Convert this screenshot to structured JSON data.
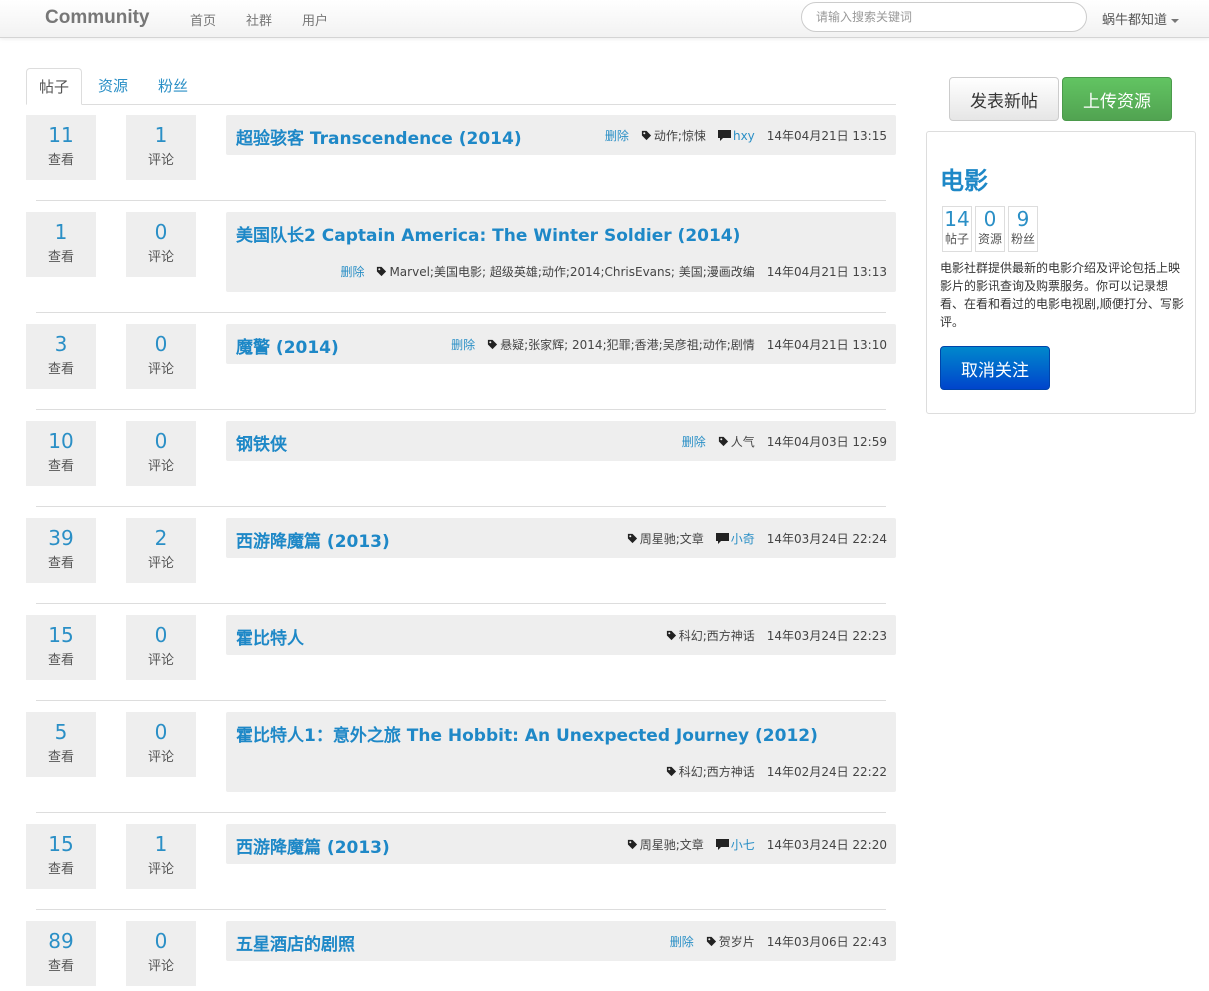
{
  "nav": {
    "brand": "Community",
    "links": [
      "首页",
      "社群",
      "用户"
    ],
    "search_placeholder": "请输入搜索关键词",
    "user": "蜗牛都知道"
  },
  "tabs": [
    "帖子",
    "资源",
    "粉丝"
  ],
  "labels": {
    "views": "查看",
    "comments": "评论",
    "delete": "删除"
  },
  "posts": [
    {
      "views": "11",
      "comments": "1",
      "title": "超验骇客 Transcendence (2014)",
      "delete": true,
      "tags": "动作;惊悚",
      "author": "hxy",
      "time": "14年04月21日 13:15"
    },
    {
      "views": "1",
      "comments": "0",
      "title": "美国队长2 Captain America: The Winter Soldier (2014)",
      "delete": true,
      "tags": "Marvel;美国电影; 超级英雄;动作;2014;ChrisEvans; 美国;漫画改编",
      "author": "",
      "time": "14年04月21日 13:13"
    },
    {
      "views": "3",
      "comments": "0",
      "title": "魔警 (2014)",
      "delete": true,
      "tags": "悬疑;张家辉; 2014;犯罪;香港;吴彦祖;动作;剧情",
      "author": "",
      "time": "14年04月21日 13:10"
    },
    {
      "views": "10",
      "comments": "0",
      "title": "钢铁侠",
      "delete": true,
      "tags": "人气",
      "author": "",
      "time": "14年04月03日 12:59"
    },
    {
      "views": "39",
      "comments": "2",
      "title": "西游降魔篇 (2013)",
      "delete": false,
      "tags": "周星驰;文章",
      "author": "小奇",
      "time": "14年03月24日 22:24"
    },
    {
      "views": "15",
      "comments": "0",
      "title": "霍比特人",
      "delete": false,
      "tags": "科幻;西方神话",
      "author": "",
      "time": "14年03月24日 22:23"
    },
    {
      "views": "5",
      "comments": "0",
      "title": "霍比特人1：意外之旅 The Hobbit: An Unexpected Journey (2012)",
      "delete": false,
      "tags": "科幻;西方神话",
      "author": "",
      "time": "14年02月24日 22:22"
    },
    {
      "views": "15",
      "comments": "1",
      "title": "西游降魔篇 (2013)",
      "delete": false,
      "tags": "周星驰;文章",
      "author": "小七",
      "time": "14年03月24日 22:20"
    },
    {
      "views": "89",
      "comments": "0",
      "title": "五星酒店的剧照",
      "delete": true,
      "tags": "贺岁片",
      "author": "",
      "time": "14年03月06日 22:43"
    }
  ],
  "sidebar": {
    "new_post": "发表新帖",
    "upload": "上传资源",
    "community": {
      "name": "电影",
      "stats": [
        {
          "value": "14",
          "label": "帖子"
        },
        {
          "value": "0",
          "label": "资源"
        },
        {
          "value": "9",
          "label": "粉丝"
        }
      ],
      "description": "电影社群提供最新的电影介绍及评论包括上映影片的影讯查询及购票服务。你可以记录想看、在看和看过的电影电视剧,顺便打分、写影评。",
      "unfollow": "取消关注"
    }
  }
}
